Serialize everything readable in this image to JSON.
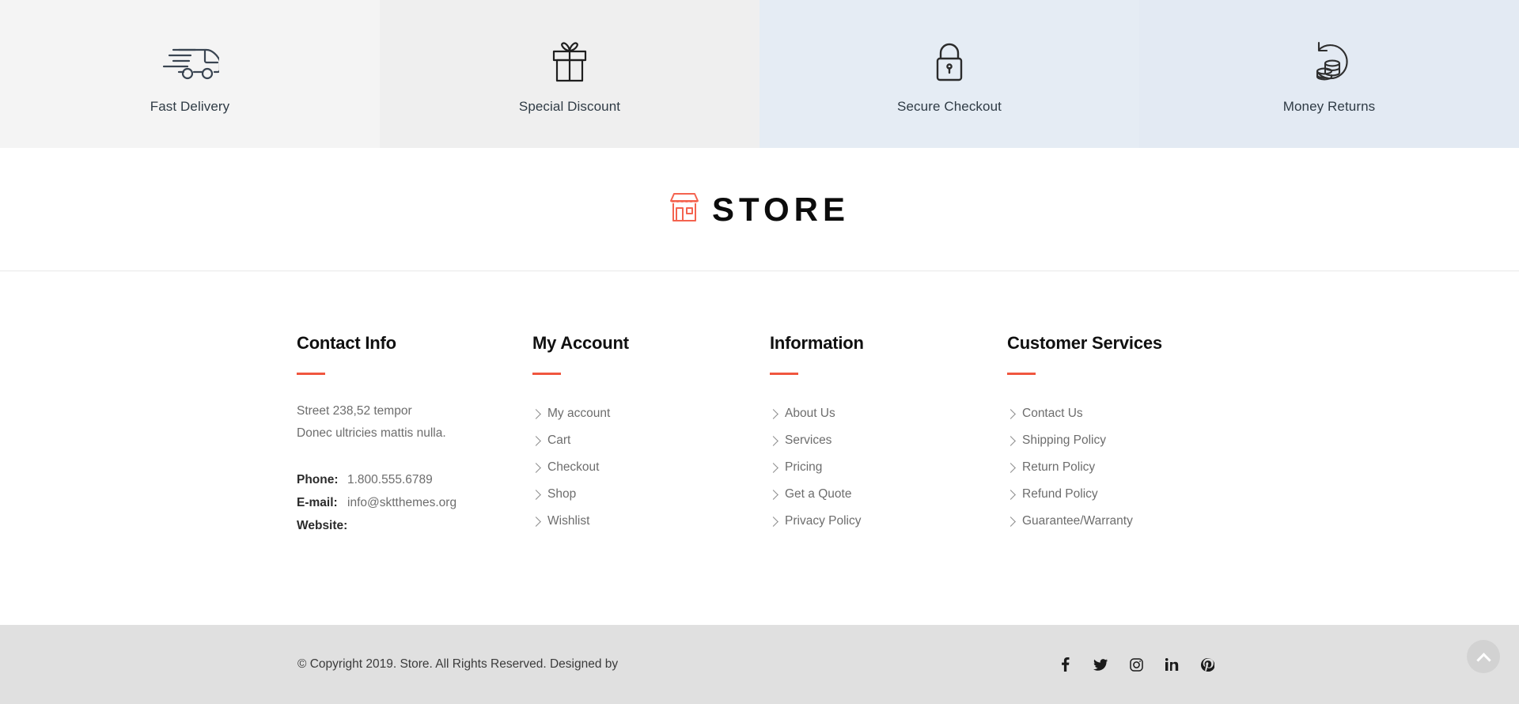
{
  "features": [
    {
      "label": "Fast Delivery",
      "icon": "delivery-truck-icon",
      "bg": "#f4f4f4"
    },
    {
      "label": "Special Discount",
      "icon": "gift-box-icon",
      "bg": "#efefef"
    },
    {
      "label": "Secure Checkout",
      "icon": "padlock-icon",
      "bg": "#e5ecf4"
    },
    {
      "label": "Money Returns",
      "icon": "coins-return-icon",
      "bg": "#e3eaf3"
    }
  ],
  "logo": {
    "text": "STORE",
    "icon": "storefront-icon",
    "icon_color": "#f4634f"
  },
  "accent_color": "#f0563f",
  "columns": {
    "contact": {
      "title": "Contact Info",
      "address": [
        "Street 238,52 tempor",
        "Donec ultricies mattis nulla."
      ],
      "rows": [
        {
          "key": "Phone:",
          "value": "1.800.555.6789"
        },
        {
          "key": "E-mail:",
          "value": "info@sktthemes.org"
        },
        {
          "key": "Website:",
          "value": ""
        }
      ]
    },
    "my_account": {
      "title": "My Account",
      "links": [
        "My account",
        "Cart",
        "Checkout",
        "Shop",
        "Wishlist"
      ]
    },
    "information": {
      "title": "Information",
      "links": [
        "About Us",
        "Services",
        "Pricing",
        "Get a Quote",
        "Privacy Policy"
      ]
    },
    "customer_services": {
      "title": "Customer Services",
      "links": [
        "Contact Us",
        "Shipping Policy",
        "Return Policy",
        "Refund Policy",
        "Guarantee/Warranty"
      ]
    }
  },
  "bottom": {
    "copyright": "© Copyright 2019. Store. All Rights Reserved. Designed by",
    "socials": [
      "facebook-icon",
      "twitter-icon",
      "instagram-icon",
      "linkedin-icon",
      "pinterest-icon"
    ],
    "scroll_top": "scroll-to-top-button"
  }
}
